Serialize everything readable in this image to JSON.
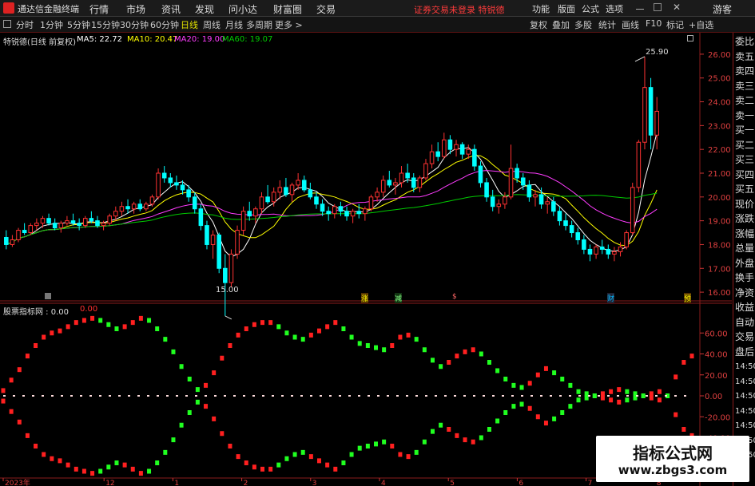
{
  "titlebar": {
    "app_title": "通达信金融终端",
    "menus": [
      "行情",
      "市场",
      "资讯",
      "发现",
      "问小达",
      "财富圈",
      "交易"
    ],
    "warning": "证券交易未登录  特锐德",
    "right_menus": [
      "功能",
      "版面",
      "公式",
      "选项"
    ],
    "guest": "游客"
  },
  "periodbar": {
    "periods": [
      "分时",
      "1分钟",
      "5分钟",
      "15分钟",
      "30分钟",
      "60分钟",
      "日线",
      "周线",
      "月线",
      "多周期",
      "更多 >"
    ],
    "active": "日线",
    "tools": [
      "复权",
      "叠加",
      "多股",
      "统计",
      "画线",
      "F10",
      "标记",
      "+自选"
    ]
  },
  "stock_legend": {
    "name": "特锐德(日线 前复权)",
    "ma5": "MA5: 22.72",
    "ma10": "MA10: 20.47",
    "ma20": "MA20: 19.00",
    "ma60": "MA60: 19.07",
    "colors": {
      "ma5": "#ffffff",
      "ma10": "#ffff00",
      "ma20": "#ff3cff",
      "ma60": "#00cc00"
    }
  },
  "indicator_legend": {
    "name": "股票指标网 : 0.00",
    "value": "0.00"
  },
  "right_panel": [
    "委比",
    "卖五",
    "卖四",
    "卖三",
    "卖二",
    "卖一",
    "买一",
    "买二",
    "买三",
    "买四",
    "买五",
    "现价",
    "涨跌",
    "涨幅",
    "总量",
    "外盘",
    "换手",
    "净资",
    "收益",
    "自动",
    "交易",
    "盘后",
    "14:50",
    "14:50",
    "14:50",
    "14:50",
    "14:50",
    "14:50",
    "14:50"
  ],
  "markers": {
    "high": "25.90",
    "low": "15.00"
  },
  "event_tags": [
    "涨",
    "减",
    "$",
    "财",
    "预"
  ],
  "watermark": {
    "title": "指标公式网",
    "url": "www.zbgs3.com"
  },
  "chart_data": [
    {
      "type": "line",
      "title": "",
      "ylim": [
        15.5,
        26.5
      ],
      "yticks": [
        "26.00",
        "25.00",
        "24.00",
        "23.00",
        "22.00",
        "21.00",
        "20.00",
        "19.00",
        "18.00",
        "17.00",
        "16.00"
      ],
      "candles": [
        [
          18.3,
          18.6,
          17.8,
          18.0
        ],
        [
          18.0,
          18.4,
          17.9,
          18.2
        ],
        [
          18.2,
          18.7,
          18.1,
          18.6
        ],
        [
          18.6,
          18.9,
          18.4,
          18.5
        ],
        [
          18.5,
          18.9,
          18.4,
          18.8
        ],
        [
          18.8,
          19.1,
          18.6,
          18.9
        ],
        [
          18.9,
          19.2,
          18.7,
          19.1
        ],
        [
          19.1,
          19.3,
          18.8,
          18.9
        ],
        [
          18.9,
          19.1,
          18.6,
          18.7
        ],
        [
          18.7,
          19.0,
          18.5,
          18.9
        ],
        [
          18.9,
          19.2,
          18.8,
          19.0
        ],
        [
          19.0,
          19.3,
          18.8,
          18.9
        ],
        [
          18.9,
          19.1,
          18.6,
          18.8
        ],
        [
          18.8,
          19.2,
          18.7,
          19.1
        ],
        [
          19.1,
          19.4,
          18.9,
          19.0
        ],
        [
          19.0,
          19.2,
          18.7,
          18.8
        ],
        [
          18.8,
          19.0,
          18.6,
          18.9
        ],
        [
          18.9,
          19.3,
          18.8,
          19.2
        ],
        [
          19.2,
          19.6,
          19.0,
          19.4
        ],
        [
          19.4,
          19.8,
          19.2,
          19.6
        ],
        [
          19.6,
          19.9,
          19.3,
          19.5
        ],
        [
          19.5,
          19.8,
          19.3,
          19.7
        ],
        [
          19.7,
          19.9,
          19.4,
          19.5
        ],
        [
          19.5,
          19.8,
          19.4,
          19.7
        ],
        [
          19.7,
          20.1,
          19.6,
          20.0
        ],
        [
          20.0,
          21.2,
          19.9,
          21.0
        ],
        [
          21.0,
          21.3,
          20.6,
          20.8
        ],
        [
          20.8,
          21.0,
          20.4,
          20.6
        ],
        [
          20.6,
          20.9,
          20.3,
          20.5
        ],
        [
          20.5,
          20.7,
          20.1,
          20.3
        ],
        [
          20.3,
          20.5,
          19.8,
          20.0
        ],
        [
          20.0,
          20.2,
          19.3,
          19.5
        ],
        [
          19.5,
          19.7,
          18.6,
          18.8
        ],
        [
          18.8,
          19.0,
          17.8,
          18.0
        ],
        [
          18.0,
          18.6,
          17.4,
          18.4
        ],
        [
          18.4,
          18.5,
          16.8,
          17.0
        ],
        [
          17.0,
          17.6,
          15.0,
          16.4
        ],
        [
          16.4,
          17.8,
          16.2,
          17.6
        ],
        [
          17.6,
          18.8,
          17.4,
          18.6
        ],
        [
          18.6,
          19.6,
          18.4,
          19.4
        ],
        [
          19.4,
          19.8,
          19.0,
          19.2
        ],
        [
          19.2,
          19.6,
          18.9,
          19.5
        ],
        [
          19.5,
          20.2,
          19.3,
          20.0
        ],
        [
          20.0,
          20.5,
          19.7,
          19.8
        ],
        [
          19.8,
          20.4,
          19.6,
          20.2
        ],
        [
          20.2,
          20.7,
          19.9,
          20.4
        ],
        [
          20.4,
          20.8,
          20.0,
          20.1
        ],
        [
          20.1,
          20.6,
          19.8,
          20.5
        ],
        [
          20.5,
          21.0,
          20.3,
          20.7
        ],
        [
          20.7,
          20.9,
          20.2,
          20.3
        ],
        [
          20.3,
          20.6,
          19.9,
          20.0
        ],
        [
          20.0,
          20.2,
          19.5,
          19.7
        ],
        [
          19.7,
          19.9,
          19.2,
          19.4
        ],
        [
          19.4,
          19.6,
          19.0,
          19.3
        ],
        [
          19.3,
          19.7,
          19.1,
          19.6
        ],
        [
          19.6,
          19.8,
          19.2,
          19.4
        ],
        [
          19.4,
          19.6,
          19.0,
          19.2
        ],
        [
          19.2,
          19.5,
          18.9,
          19.4
        ],
        [
          19.4,
          19.7,
          19.1,
          19.3
        ],
        [
          19.3,
          19.6,
          19.0,
          19.5
        ],
        [
          19.5,
          20.1,
          19.4,
          20.0
        ],
        [
          20.0,
          20.4,
          19.8,
          20.2
        ],
        [
          20.2,
          20.9,
          20.0,
          20.7
        ],
        [
          20.7,
          21.1,
          20.4,
          20.5
        ],
        [
          20.5,
          20.8,
          20.1,
          20.6
        ],
        [
          20.6,
          21.3,
          20.4,
          21.0
        ],
        [
          21.0,
          21.4,
          20.6,
          20.8
        ],
        [
          20.8,
          21.0,
          20.2,
          20.4
        ],
        [
          20.4,
          20.9,
          20.2,
          20.8
        ],
        [
          20.8,
          21.6,
          20.7,
          21.4
        ],
        [
          21.4,
          22.2,
          21.2,
          21.9
        ],
        [
          21.9,
          22.3,
          21.5,
          21.7
        ],
        [
          21.7,
          22.7,
          21.6,
          22.4
        ],
        [
          22.4,
          22.6,
          21.8,
          22.0
        ],
        [
          22.0,
          22.4,
          21.7,
          22.2
        ],
        [
          22.2,
          22.3,
          21.6,
          21.8
        ],
        [
          21.8,
          22.2,
          21.6,
          22.0
        ],
        [
          22.0,
          22.2,
          21.1,
          21.3
        ],
        [
          21.3,
          21.5,
          20.4,
          20.6
        ],
        [
          20.6,
          20.8,
          19.8,
          20.0
        ],
        [
          20.0,
          20.3,
          19.4,
          19.6
        ],
        [
          19.6,
          19.9,
          19.3,
          19.7
        ],
        [
          19.7,
          20.2,
          19.5,
          20.0
        ],
        [
          20.0,
          22.2,
          19.9,
          21.2
        ],
        [
          21.2,
          21.4,
          20.6,
          20.8
        ],
        [
          20.8,
          21.0,
          20.3,
          20.5
        ],
        [
          20.5,
          20.7,
          19.8,
          20.0
        ],
        [
          20.0,
          20.3,
          19.6,
          20.1
        ],
        [
          20.1,
          20.4,
          19.5,
          19.7
        ],
        [
          19.7,
          20.0,
          19.3,
          19.8
        ],
        [
          19.8,
          20.0,
          19.2,
          19.4
        ],
        [
          19.4,
          19.6,
          18.8,
          19.0
        ],
        [
          19.0,
          19.3,
          18.6,
          18.8
        ],
        [
          18.8,
          19.0,
          18.3,
          18.5
        ],
        [
          18.5,
          18.7,
          18.0,
          18.2
        ],
        [
          18.2,
          18.4,
          17.6,
          17.8
        ],
        [
          17.8,
          18.0,
          17.3,
          17.6
        ],
        [
          17.6,
          18.0,
          17.4,
          17.9
        ],
        [
          17.9,
          18.2,
          17.6,
          17.8
        ],
        [
          17.8,
          18.0,
          17.4,
          17.6
        ],
        [
          17.6,
          17.9,
          17.3,
          17.7
        ],
        [
          17.7,
          18.1,
          17.5,
          17.9
        ],
        [
          17.9,
          18.6,
          17.8,
          18.5
        ],
        [
          18.5,
          20.6,
          18.4,
          20.4
        ],
        [
          20.4,
          22.4,
          20.2,
          22.3
        ],
        [
          22.3,
          25.9,
          22.0,
          24.6
        ],
        [
          24.6,
          25.0,
          22.0,
          22.6
        ],
        [
          22.6,
          24.2,
          22.0,
          23.6
        ]
      ]
    },
    {
      "type": "line",
      "title": "",
      "ylim": [
        -80,
        80
      ],
      "yticks": [
        "60.00",
        "40.00",
        "20.00",
        "0.00",
        "-20.00",
        "-40.00",
        "-60.00"
      ],
      "xlabels": [
        "2023年",
        "12",
        "1",
        "2",
        "3",
        "4",
        "5",
        "6",
        "7",
        "8"
      ],
      "upper": [
        5,
        15,
        25,
        38,
        48,
        56,
        60,
        62,
        66,
        70,
        72,
        74,
        72,
        68,
        64,
        66,
        70,
        74,
        72,
        64,
        54,
        42,
        28,
        16,
        6,
        10,
        22,
        36,
        48,
        58,
        64,
        68,
        70,
        70,
        66,
        60,
        56,
        54,
        58,
        62,
        66,
        70,
        64,
        56,
        50,
        48,
        46,
        44,
        48,
        56,
        58,
        54,
        44,
        34,
        28,
        32,
        38,
        42,
        44,
        40,
        32,
        24,
        16,
        10,
        8,
        12,
        20,
        26,
        22,
        16,
        10,
        4,
        2,
        0,
        2,
        4,
        6,
        4,
        2,
        0,
        2,
        4,
        0,
        18,
        32,
        38
      ]
    }
  ]
}
